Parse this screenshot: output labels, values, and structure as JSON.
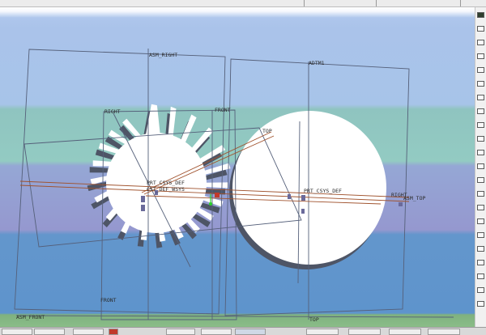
{
  "datums": {
    "asm_right": "ASM_RIGHT",
    "adtm1": "ADTM1",
    "right_1": "RIGHT",
    "front_1": "FRONT",
    "top_1": "TOP",
    "prt_csys_def_1": "PRT_CSYS_DEF",
    "csys_sub": "CST_DEF_WSYS",
    "prt_csys_def_2": "PRT_CSYS_DEF",
    "right_2": "RIGHT",
    "asm_top": "ASM_TOP",
    "front_2": "FRONT",
    "asm_front": "ASM_FRONT",
    "top_2": "TOP"
  },
  "colors": {
    "datum_plane": "#55607a",
    "axis_line": "#a0522d",
    "gear_fill": "#ffffff",
    "gear_shadow": "#4e5566"
  },
  "icons": {
    "right_panel": [
      "model-tree-icon",
      "layers-icon",
      "datum-icon",
      "axis-icon",
      "point-icon",
      "csys-icon",
      "sketch-icon",
      "plane-icon",
      "datum-axis-icon",
      "datum-point-icon",
      "feature-icon",
      "annotation-icon",
      "material-icon",
      "analysis-icon",
      "view-icon",
      "render-icon",
      "display-icon",
      "appearance-icon",
      "settings-icon",
      "help-icon",
      "search-icon",
      "close-icon"
    ]
  }
}
